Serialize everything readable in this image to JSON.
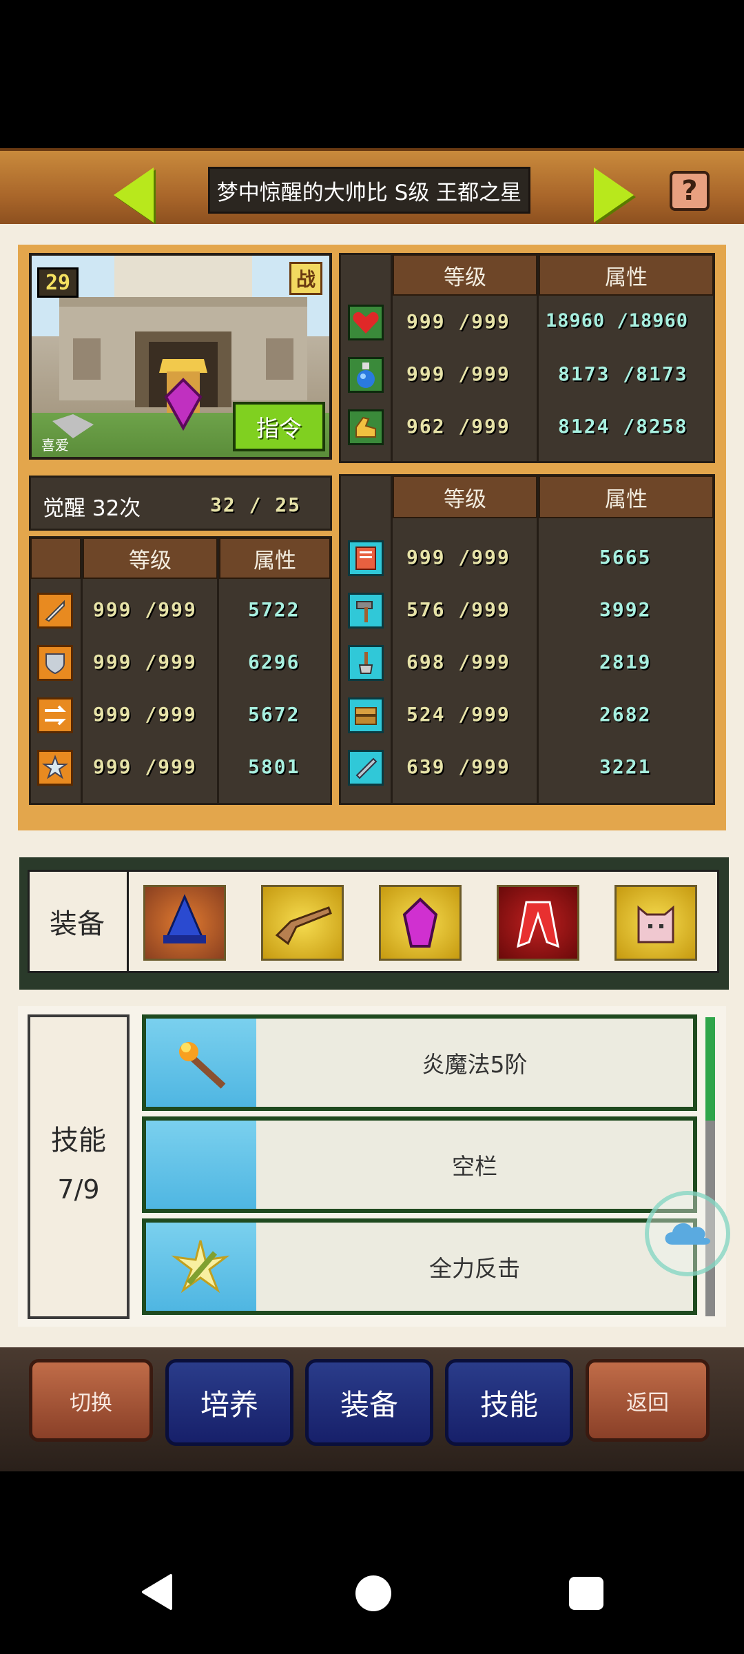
{
  "header": {
    "title": "梦中惊醒的大帅比 S级 王都之星",
    "help_label": "?"
  },
  "portrait": {
    "level": "29",
    "battle_badge": "战",
    "like_label": "喜爱",
    "command_label": "指令"
  },
  "top_stats": {
    "col_level": "等级",
    "col_attr": "属性",
    "rows": [
      {
        "icon": "heart-icon",
        "level": "999 /999",
        "attr": "18960 /18960"
      },
      {
        "icon": "potion-icon",
        "level": "999 /999",
        "attr": "8173 /8173"
      },
      {
        "icon": "strength-arm-icon",
        "level": "962 /999",
        "attr": "8124 /8258"
      }
    ]
  },
  "awaken": {
    "label": "觉醒 32次",
    "count": "32 / 25"
  },
  "left_stats": {
    "col_level": "等级",
    "col_attr": "属性",
    "rows": [
      {
        "icon": "sword-icon",
        "level": "999 /999",
        "attr": "5722"
      },
      {
        "icon": "shield-icon",
        "level": "999 /999",
        "attr": "6296"
      },
      {
        "icon": "speed-arrows-icon",
        "level": "999 /999",
        "attr": "5672"
      },
      {
        "icon": "star-icon",
        "level": "999 /999",
        "attr": "5801"
      }
    ]
  },
  "right_stats": {
    "col_level": "等级",
    "col_attr": "属性",
    "rows": [
      {
        "icon": "book-icon",
        "level": "999 /999",
        "attr": "5665"
      },
      {
        "icon": "hammer-icon",
        "level": "576 /999",
        "attr": "3992"
      },
      {
        "icon": "shovel-icon",
        "level": "698 /999",
        "attr": "2819"
      },
      {
        "icon": "chest-icon",
        "level": "524 /999",
        "attr": "2682"
      },
      {
        "icon": "tool-icon",
        "level": "639 /999",
        "attr": "3221"
      }
    ]
  },
  "equipment": {
    "label": "装备",
    "slots": [
      "wizard-hat-icon",
      "musket-icon",
      "purple-gem-icon",
      "red-cape-icon",
      "cat-mask-icon"
    ]
  },
  "skills": {
    "label": "技能",
    "count": "7/9",
    "items": [
      {
        "icon": "fire-staff-icon",
        "name": "炎魔法5阶"
      },
      {
        "icon": "",
        "name": "空栏"
      },
      {
        "icon": "counter-sword-icon",
        "name": "全力反击"
      }
    ]
  },
  "bottom_buttons": {
    "switch": "切换",
    "train": "培养",
    "equip": "装备",
    "skill": "技能",
    "back": "返回"
  },
  "colors": {
    "accent_green": "#b8e81c",
    "panel_orange": "#e3a64c",
    "stat_dark": "#3e362d",
    "header_brown": "#6e4628"
  }
}
